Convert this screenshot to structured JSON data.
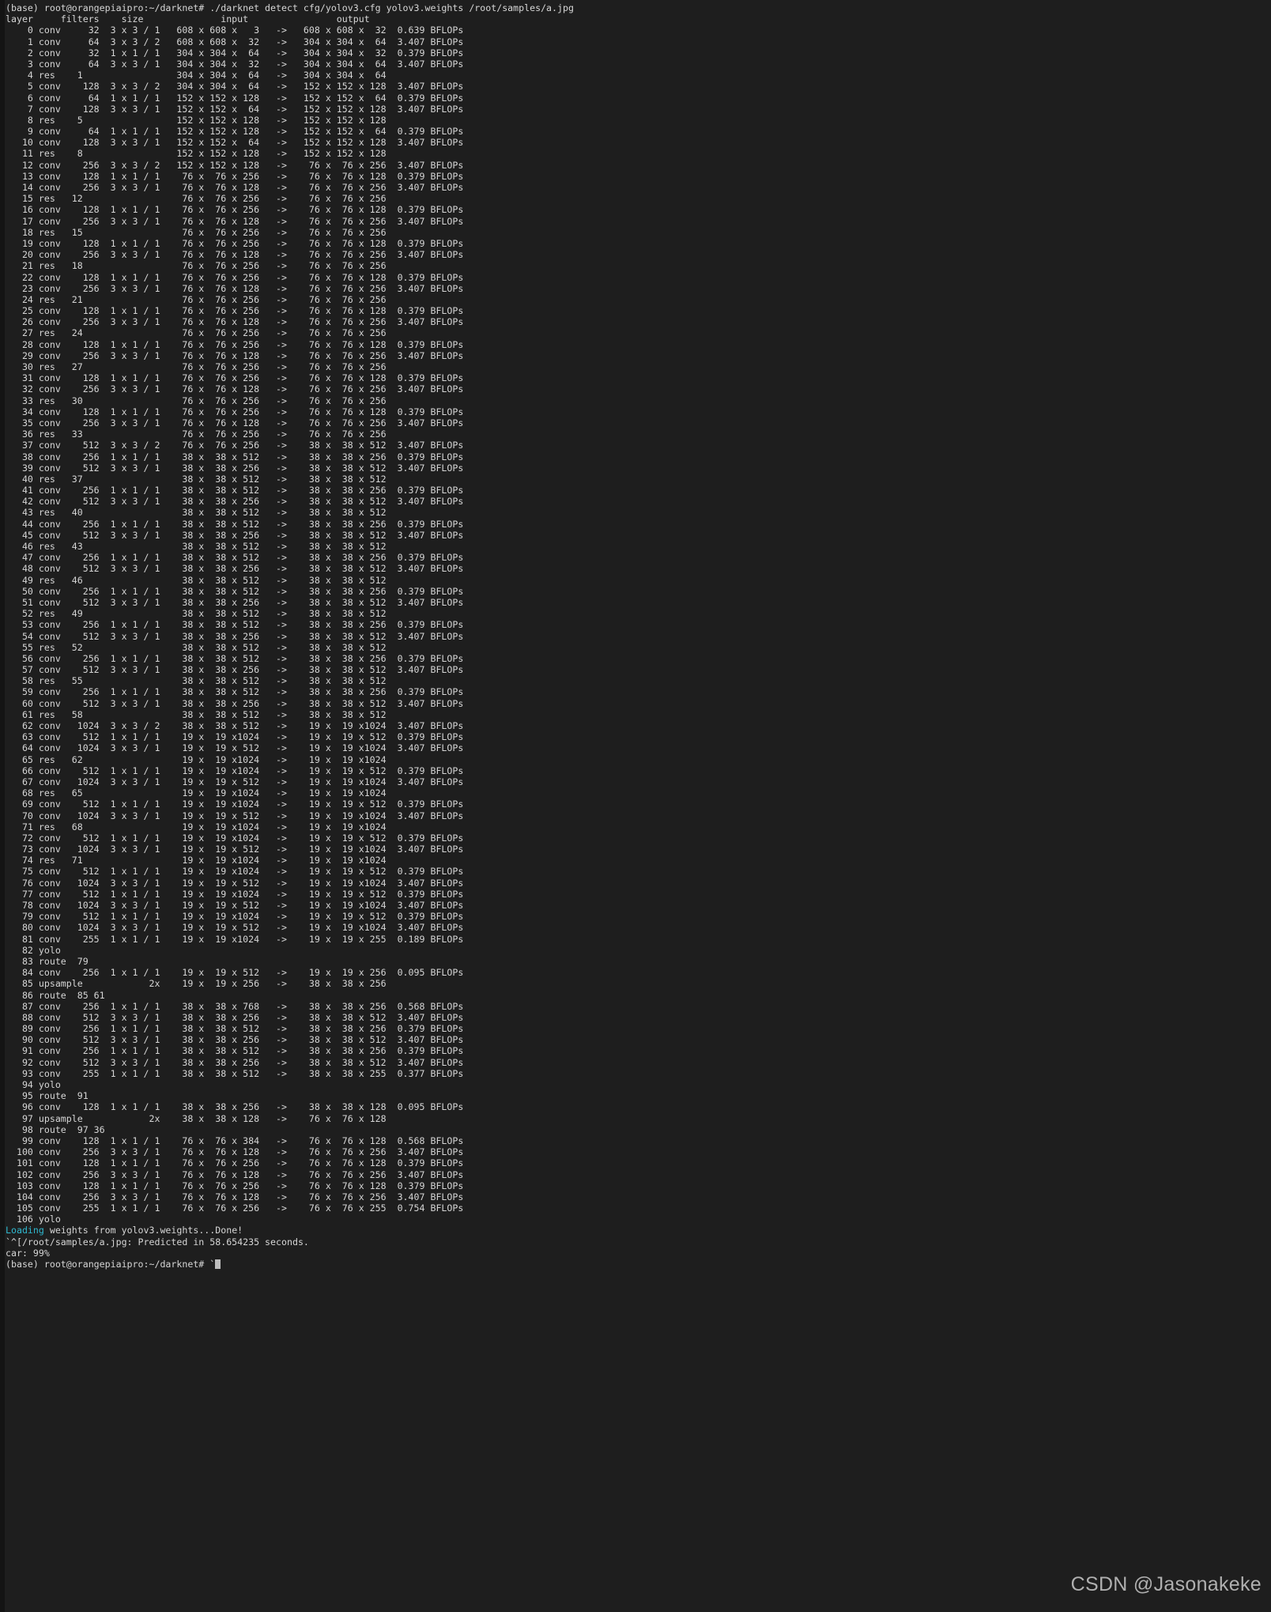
{
  "terminal": {
    "background": "#1e1e1e",
    "foreground": "#d6d6d6",
    "accent_cyan": "#2fb8cf",
    "prompt": "(base) root@orangepiaipro:~/darknet#",
    "command": "./darknet detect cfg/yolov3.cfg yolov3.weights /root/samples/a.jpg",
    "command_line": "(base) root@orangepiaipro:~/darknet# ./darknet detect cfg/yolov3.cfg yolov3.weights /root/samples/a.jpg",
    "header_line": "layer     filters    size              input                output",
    "columns": [
      "layer",
      "filters",
      "size",
      "input",
      "output"
    ],
    "loading_keyword": "Loading",
    "loading_rest": " weights from yolov3.weights...Done!",
    "predicted_line": "`^[/root/samples/a.jpg: Predicted in 58.654235 seconds.",
    "detection_line": "car: 99%",
    "final_prompt_line": "(base) root@orangepiaipro:~/darknet# `",
    "predicted_seconds": "58.654235",
    "predicted_image": "/root/samples/a.jpg",
    "detections": [
      {
        "label": "car",
        "confidence": "99%"
      }
    ]
  },
  "watermark": {
    "text": "CSDN @Jasonakeke"
  },
  "network": {
    "name": "yolov3",
    "input_size": "608 x 608 x 3",
    "rows": [
      "    0 conv     32  3 x 3 / 1   608 x 608 x   3   ->   608 x 608 x  32  0.639 BFLOPs",
      "    1 conv     64  3 x 3 / 2   608 x 608 x  32   ->   304 x 304 x  64  3.407 BFLOPs",
      "    2 conv     32  1 x 1 / 1   304 x 304 x  64   ->   304 x 304 x  32  0.379 BFLOPs",
      "    3 conv     64  3 x 3 / 1   304 x 304 x  32   ->   304 x 304 x  64  3.407 BFLOPs",
      "    4 res    1                 304 x 304 x  64   ->   304 x 304 x  64",
      "    5 conv    128  3 x 3 / 2   304 x 304 x  64   ->   152 x 152 x 128  3.407 BFLOPs",
      "    6 conv     64  1 x 1 / 1   152 x 152 x 128   ->   152 x 152 x  64  0.379 BFLOPs",
      "    7 conv    128  3 x 3 / 1   152 x 152 x  64   ->   152 x 152 x 128  3.407 BFLOPs",
      "    8 res    5                 152 x 152 x 128   ->   152 x 152 x 128",
      "    9 conv     64  1 x 1 / 1   152 x 152 x 128   ->   152 x 152 x  64  0.379 BFLOPs",
      "   10 conv    128  3 x 3 / 1   152 x 152 x  64   ->   152 x 152 x 128  3.407 BFLOPs",
      "   11 res    8                 152 x 152 x 128   ->   152 x 152 x 128",
      "   12 conv    256  3 x 3 / 2   152 x 152 x 128   ->    76 x  76 x 256  3.407 BFLOPs",
      "   13 conv    128  1 x 1 / 1    76 x  76 x 256   ->    76 x  76 x 128  0.379 BFLOPs",
      "   14 conv    256  3 x 3 / 1    76 x  76 x 128   ->    76 x  76 x 256  3.407 BFLOPs",
      "   15 res   12                  76 x  76 x 256   ->    76 x  76 x 256",
      "   16 conv    128  1 x 1 / 1    76 x  76 x 256   ->    76 x  76 x 128  0.379 BFLOPs",
      "   17 conv    256  3 x 3 / 1    76 x  76 x 128   ->    76 x  76 x 256  3.407 BFLOPs",
      "   18 res   15                  76 x  76 x 256   ->    76 x  76 x 256",
      "   19 conv    128  1 x 1 / 1    76 x  76 x 256   ->    76 x  76 x 128  0.379 BFLOPs",
      "   20 conv    256  3 x 3 / 1    76 x  76 x 128   ->    76 x  76 x 256  3.407 BFLOPs",
      "   21 res   18                  76 x  76 x 256   ->    76 x  76 x 256",
      "   22 conv    128  1 x 1 / 1    76 x  76 x 256   ->    76 x  76 x 128  0.379 BFLOPs",
      "   23 conv    256  3 x 3 / 1    76 x  76 x 128   ->    76 x  76 x 256  3.407 BFLOPs",
      "   24 res   21                  76 x  76 x 256   ->    76 x  76 x 256",
      "   25 conv    128  1 x 1 / 1    76 x  76 x 256   ->    76 x  76 x 128  0.379 BFLOPs",
      "   26 conv    256  3 x 3 / 1    76 x  76 x 128   ->    76 x  76 x 256  3.407 BFLOPs",
      "   27 res   24                  76 x  76 x 256   ->    76 x  76 x 256",
      "   28 conv    128  1 x 1 / 1    76 x  76 x 256   ->    76 x  76 x 128  0.379 BFLOPs",
      "   29 conv    256  3 x 3 / 1    76 x  76 x 128   ->    76 x  76 x 256  3.407 BFLOPs",
      "   30 res   27                  76 x  76 x 256   ->    76 x  76 x 256",
      "   31 conv    128  1 x 1 / 1    76 x  76 x 256   ->    76 x  76 x 128  0.379 BFLOPs",
      "   32 conv    256  3 x 3 / 1    76 x  76 x 128   ->    76 x  76 x 256  3.407 BFLOPs",
      "   33 res   30                  76 x  76 x 256   ->    76 x  76 x 256",
      "   34 conv    128  1 x 1 / 1    76 x  76 x 256   ->    76 x  76 x 128  0.379 BFLOPs",
      "   35 conv    256  3 x 3 / 1    76 x  76 x 128   ->    76 x  76 x 256  3.407 BFLOPs",
      "   36 res   33                  76 x  76 x 256   ->    76 x  76 x 256",
      "   37 conv    512  3 x 3 / 2    76 x  76 x 256   ->    38 x  38 x 512  3.407 BFLOPs",
      "   38 conv    256  1 x 1 / 1    38 x  38 x 512   ->    38 x  38 x 256  0.379 BFLOPs",
      "   39 conv    512  3 x 3 / 1    38 x  38 x 256   ->    38 x  38 x 512  3.407 BFLOPs",
      "   40 res   37                  38 x  38 x 512   ->    38 x  38 x 512",
      "   41 conv    256  1 x 1 / 1    38 x  38 x 512   ->    38 x  38 x 256  0.379 BFLOPs",
      "   42 conv    512  3 x 3 / 1    38 x  38 x 256   ->    38 x  38 x 512  3.407 BFLOPs",
      "   43 res   40                  38 x  38 x 512   ->    38 x  38 x 512",
      "   44 conv    256  1 x 1 / 1    38 x  38 x 512   ->    38 x  38 x 256  0.379 BFLOPs",
      "   45 conv    512  3 x 3 / 1    38 x  38 x 256   ->    38 x  38 x 512  3.407 BFLOPs",
      "   46 res   43                  38 x  38 x 512   ->    38 x  38 x 512",
      "   47 conv    256  1 x 1 / 1    38 x  38 x 512   ->    38 x  38 x 256  0.379 BFLOPs",
      "   48 conv    512  3 x 3 / 1    38 x  38 x 256   ->    38 x  38 x 512  3.407 BFLOPs",
      "   49 res   46                  38 x  38 x 512   ->    38 x  38 x 512",
      "   50 conv    256  1 x 1 / 1    38 x  38 x 512   ->    38 x  38 x 256  0.379 BFLOPs",
      "   51 conv    512  3 x 3 / 1    38 x  38 x 256   ->    38 x  38 x 512  3.407 BFLOPs",
      "   52 res   49                  38 x  38 x 512   ->    38 x  38 x 512",
      "   53 conv    256  1 x 1 / 1    38 x  38 x 512   ->    38 x  38 x 256  0.379 BFLOPs",
      "   54 conv    512  3 x 3 / 1    38 x  38 x 256   ->    38 x  38 x 512  3.407 BFLOPs",
      "   55 res   52                  38 x  38 x 512   ->    38 x  38 x 512",
      "   56 conv    256  1 x 1 / 1    38 x  38 x 512   ->    38 x  38 x 256  0.379 BFLOPs",
      "   57 conv    512  3 x 3 / 1    38 x  38 x 256   ->    38 x  38 x 512  3.407 BFLOPs",
      "   58 res   55                  38 x  38 x 512   ->    38 x  38 x 512",
      "   59 conv    256  1 x 1 / 1    38 x  38 x 512   ->    38 x  38 x 256  0.379 BFLOPs",
      "   60 conv    512  3 x 3 / 1    38 x  38 x 256   ->    38 x  38 x 512  3.407 BFLOPs",
      "   61 res   58                  38 x  38 x 512   ->    38 x  38 x 512",
      "   62 conv   1024  3 x 3 / 2    38 x  38 x 512   ->    19 x  19 x1024  3.407 BFLOPs",
      "   63 conv    512  1 x 1 / 1    19 x  19 x1024   ->    19 x  19 x 512  0.379 BFLOPs",
      "   64 conv   1024  3 x 3 / 1    19 x  19 x 512   ->    19 x  19 x1024  3.407 BFLOPs",
      "   65 res   62                  19 x  19 x1024   ->    19 x  19 x1024",
      "   66 conv    512  1 x 1 / 1    19 x  19 x1024   ->    19 x  19 x 512  0.379 BFLOPs",
      "   67 conv   1024  3 x 3 / 1    19 x  19 x 512   ->    19 x  19 x1024  3.407 BFLOPs",
      "   68 res   65                  19 x  19 x1024   ->    19 x  19 x1024",
      "   69 conv    512  1 x 1 / 1    19 x  19 x1024   ->    19 x  19 x 512  0.379 BFLOPs",
      "   70 conv   1024  3 x 3 / 1    19 x  19 x 512   ->    19 x  19 x1024  3.407 BFLOPs",
      "   71 res   68                  19 x  19 x1024   ->    19 x  19 x1024",
      "   72 conv    512  1 x 1 / 1    19 x  19 x1024   ->    19 x  19 x 512  0.379 BFLOPs",
      "   73 conv   1024  3 x 3 / 1    19 x  19 x 512   ->    19 x  19 x1024  3.407 BFLOPs",
      "   74 res   71                  19 x  19 x1024   ->    19 x  19 x1024",
      "   75 conv    512  1 x 1 / 1    19 x  19 x1024   ->    19 x  19 x 512  0.379 BFLOPs",
      "   76 conv   1024  3 x 3 / 1    19 x  19 x 512   ->    19 x  19 x1024  3.407 BFLOPs",
      "   77 conv    512  1 x 1 / 1    19 x  19 x1024   ->    19 x  19 x 512  0.379 BFLOPs",
      "   78 conv   1024  3 x 3 / 1    19 x  19 x 512   ->    19 x  19 x1024  3.407 BFLOPs",
      "   79 conv    512  1 x 1 / 1    19 x  19 x1024   ->    19 x  19 x 512  0.379 BFLOPs",
      "   80 conv   1024  3 x 3 / 1    19 x  19 x 512   ->    19 x  19 x1024  3.407 BFLOPs",
      "   81 conv    255  1 x 1 / 1    19 x  19 x1024   ->    19 x  19 x 255  0.189 BFLOPs",
      "   82 yolo",
      "   83 route  79",
      "   84 conv    256  1 x 1 / 1    19 x  19 x 512   ->    19 x  19 x 256  0.095 BFLOPs",
      "   85 upsample            2x    19 x  19 x 256   ->    38 x  38 x 256",
      "   86 route  85 61",
      "   87 conv    256  1 x 1 / 1    38 x  38 x 768   ->    38 x  38 x 256  0.568 BFLOPs",
      "   88 conv    512  3 x 3 / 1    38 x  38 x 256   ->    38 x  38 x 512  3.407 BFLOPs",
      "   89 conv    256  1 x 1 / 1    38 x  38 x 512   ->    38 x  38 x 256  0.379 BFLOPs",
      "   90 conv    512  3 x 3 / 1    38 x  38 x 256   ->    38 x  38 x 512  3.407 BFLOPs",
      "   91 conv    256  1 x 1 / 1    38 x  38 x 512   ->    38 x  38 x 256  0.379 BFLOPs",
      "   92 conv    512  3 x 3 / 1    38 x  38 x 256   ->    38 x  38 x 512  3.407 BFLOPs",
      "   93 conv    255  1 x 1 / 1    38 x  38 x 512   ->    38 x  38 x 255  0.377 BFLOPs",
      "   94 yolo",
      "   95 route  91",
      "   96 conv    128  1 x 1 / 1    38 x  38 x 256   ->    38 x  38 x 128  0.095 BFLOPs",
      "   97 upsample            2x    38 x  38 x 128   ->    76 x  76 x 128",
      "   98 route  97 36",
      "   99 conv    128  1 x 1 / 1    76 x  76 x 384   ->    76 x  76 x 128  0.568 BFLOPs",
      "  100 conv    256  3 x 3 / 1    76 x  76 x 128   ->    76 x  76 x 256  3.407 BFLOPs",
      "  101 conv    128  1 x 1 / 1    76 x  76 x 256   ->    76 x  76 x 128  0.379 BFLOPs",
      "  102 conv    256  3 x 3 / 1    76 x  76 x 128   ->    76 x  76 x 256  3.407 BFLOPs",
      "  103 conv    128  1 x 1 / 1    76 x  76 x 256   ->    76 x  76 x 128  0.379 BFLOPs",
      "  104 conv    256  3 x 3 / 1    76 x  76 x 128   ->    76 x  76 x 256  3.407 BFLOPs",
      "  105 conv    255  1 x 1 / 1    76 x  76 x 256   ->    76 x  76 x 255  0.754 BFLOPs",
      "  106 yolo"
    ]
  }
}
